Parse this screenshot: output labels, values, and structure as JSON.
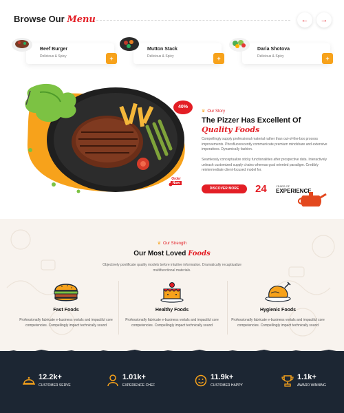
{
  "browse": {
    "title": "Browse Our",
    "title_script": "Menu",
    "prev_arrow": "←",
    "next_arrow": "→",
    "items": [
      {
        "name": "Beef Burger",
        "desc": "Delicious & Spicy",
        "add": "+"
      },
      {
        "name": "Mutton Stack",
        "desc": "Delicious & Spicy",
        "add": "+"
      },
      {
        "name": "Daria Shotova",
        "desc": "Delicious & Spicy",
        "add": "+"
      }
    ]
  },
  "story": {
    "badge": "40%",
    "order_top": "Order",
    "order_now": "Now",
    "eyebrow": "Our Story",
    "title": "The Pizzer Has Excellent Of",
    "title_script": "Quality Foods",
    "para1": "Compellingly supply professional material rather than out-of-the-box process improvements. Phosfluorescently communicate premium mindshare and extensive imperatives. Dynamically fashion.",
    "para2": "Seamlessly conceptualize sticky functionalities after prospective data. Interactively unleash customized supply chains whereas goal oriented paradigm. Credibly reintermediate client-focused model for.",
    "button": "DISCOVER MORE",
    "years_number": "24",
    "years_small": "YEARS OF",
    "years_big": "EXPERIENCE"
  },
  "strength": {
    "eyebrow": "Our Strength",
    "title": "Our Most Loved",
    "title_script": "Foods",
    "subtitle": "Objectively pontificate quality models before intuitive information. Dramatically recaptiualize multifunctional materials.",
    "features": [
      {
        "name": "Fast Foods",
        "desc": "Professionally fabricate e-business vortals and impactful core competencies. Compellingly impact technically sound"
      },
      {
        "name": "Healthy Foods",
        "desc": "Professionally fabricate e-business vortals and impactful core competencies. Compellingly impact technically sound"
      },
      {
        "name": "Hygienic Foods",
        "desc": "Professionally fabricate e-business vortals and impactful core competencies. Compellingly impact technically sound"
      }
    ]
  },
  "stats": [
    {
      "number": "12.2k+",
      "label": "CUSTOMER SERVE"
    },
    {
      "number": "1.01k+",
      "label": "EXPERIENCE CHEF"
    },
    {
      "number": "11.9k+",
      "label": "CUSTOMER HAPPY"
    },
    {
      "number": "1.1k+",
      "label": "AWARD WINNING"
    }
  ],
  "colors": {
    "accent_red": "#e31e25",
    "accent_orange": "#f7a21b",
    "dark_navy": "#1c2633",
    "cream": "#f8f3ee"
  }
}
